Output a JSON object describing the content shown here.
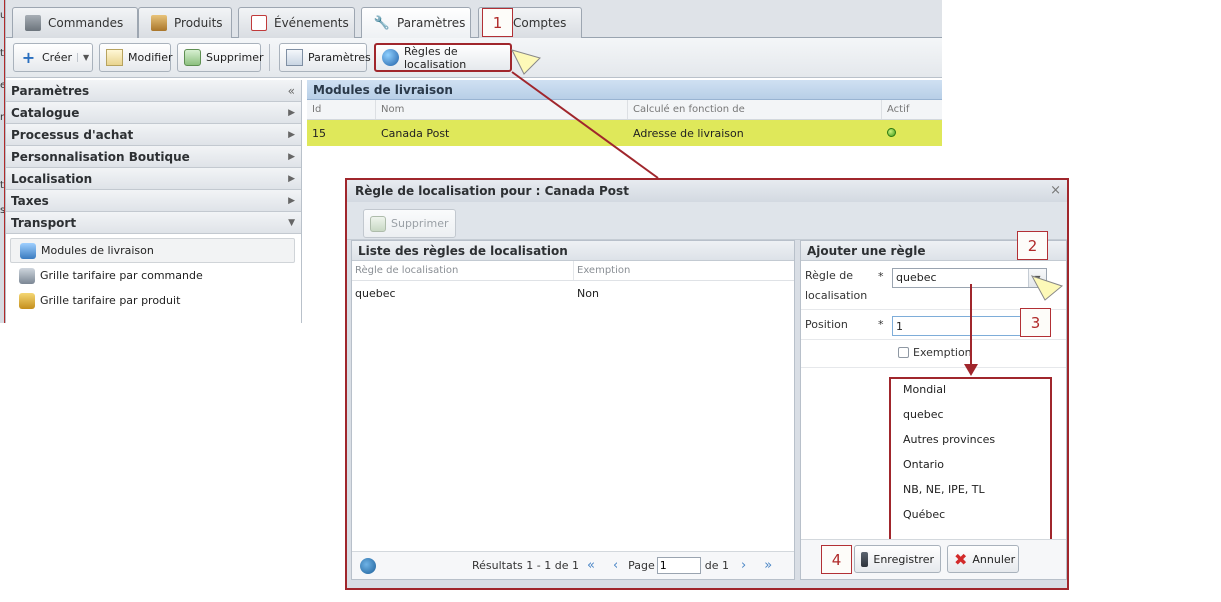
{
  "left_strip_chars": [
    "ut",
    "t",
    "e",
    "r",
    "tr",
    "s"
  ],
  "tabs": [
    {
      "label": "Commandes",
      "icon": "orders-icon",
      "active": false
    },
    {
      "label": "Produits",
      "icon": "products-icon",
      "active": false
    },
    {
      "label": "Événements",
      "icon": "events-icon",
      "active": false
    },
    {
      "label": "Paramètres",
      "icon": "wrench-icon",
      "active": true
    },
    {
      "label": "Comptes",
      "icon": "accounts-icon",
      "active": false
    }
  ],
  "toolbar": {
    "create_label": "Créer",
    "edit_label": "Modifier",
    "delete_label": "Supprimer",
    "params_label": "Paramètres",
    "localization_rules_label": "Règles de localisation"
  },
  "sidebar": {
    "title": "Paramètres",
    "collapse_glyph": "«",
    "sections": [
      "Catalogue",
      "Processus d'achat",
      "Personnalisation Boutique",
      "Localisation",
      "Taxes",
      "Transport"
    ],
    "items": [
      "Modules de livraison",
      "Grille tarifaire par commande",
      "Grille tarifaire par produit"
    ]
  },
  "grid": {
    "title": "Modules de livraison",
    "columns": [
      "Id",
      "Nom",
      "Calculé en fonction de",
      "Actif"
    ],
    "rows": [
      {
        "id": "15",
        "name": "Canada Post",
        "basis": "Adresse de livraison",
        "active": true
      }
    ],
    "highlight_color": "#dfe85a"
  },
  "dialog": {
    "title": "Règle de localisation pour : Canada Post",
    "close_glyph": "×",
    "delete_label": "Supprimer",
    "list_panel": {
      "title": "Liste des règles de localisation",
      "columns": [
        "Règle de localisation",
        "Exemption"
      ],
      "rows": [
        {
          "rule": "quebec",
          "exemption": "Non"
        }
      ]
    },
    "pager": {
      "results": "Résultats 1 - 1 de 1",
      "page_label": "Page",
      "page_value": "1",
      "of_label": "de 1"
    },
    "add_panel": {
      "title": "Ajouter une règle",
      "rule_label_1": "Règle de",
      "rule_label_2": "localisation",
      "rule_value": "quebec",
      "position_label": "Position",
      "position_value": "1",
      "required_mark": "*",
      "exemption_label": "Exemption",
      "options": [
        "Mondial",
        "quebec",
        "Autres provinces",
        "Ontario",
        "NB, NE, IPE, TL",
        "Québec"
      ],
      "save_label": "Enregistrer",
      "cancel_label": "Annuler"
    }
  },
  "annotations": {
    "callout_1": "1",
    "callout_2": "2",
    "callout_3": "3",
    "callout_4": "4"
  },
  "colors": {
    "annotation_red": "#a0262c",
    "grid_header": "#b8cfe7"
  }
}
